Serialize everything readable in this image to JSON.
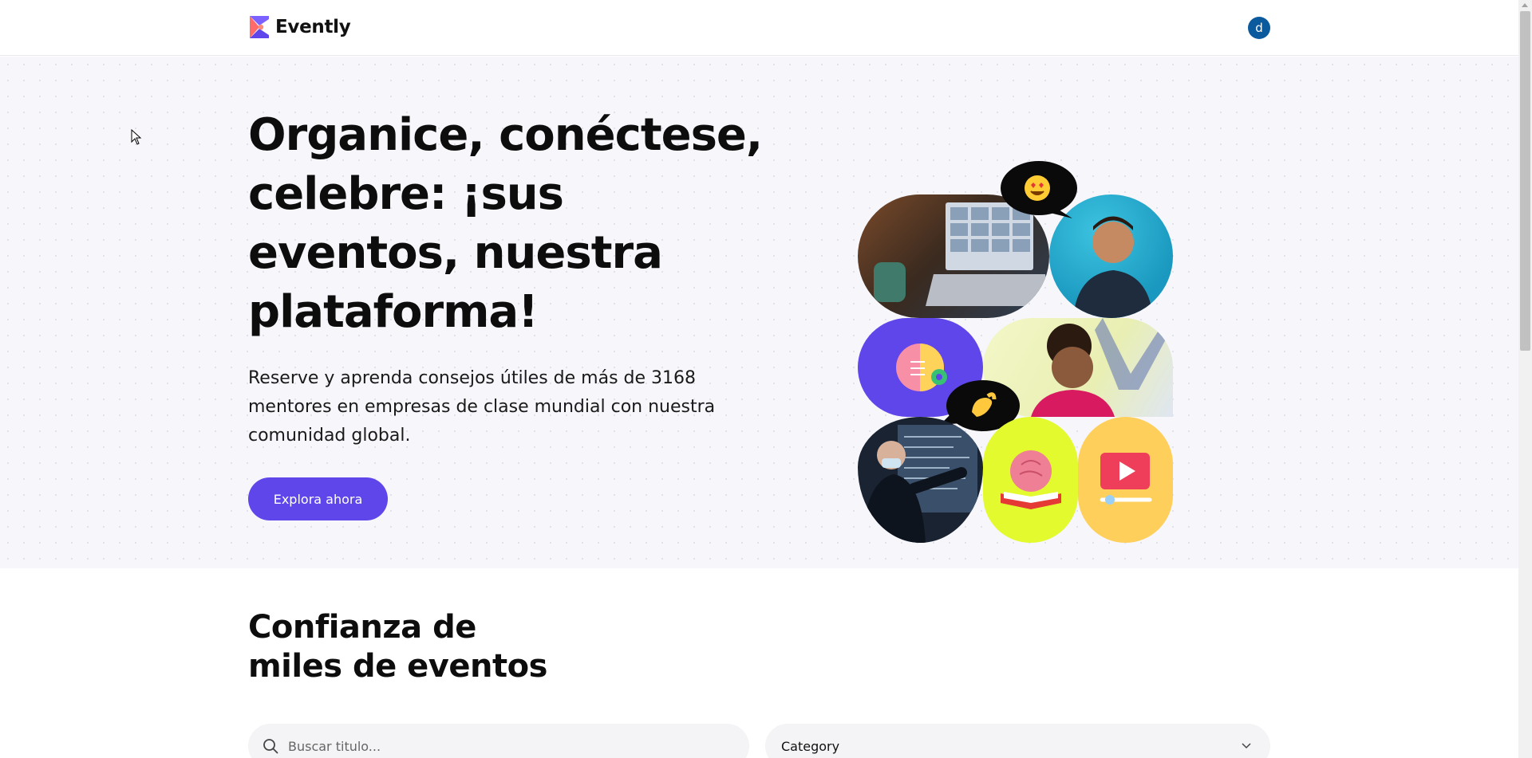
{
  "header": {
    "brand": "Evently",
    "avatar_initial": "d"
  },
  "hero": {
    "title": "Organice, conéctese, celebre: ¡sus eventos, nuestra plataforma!",
    "description": "Reserve y aprenda consejos útiles de más de 3168 mentores en empresas de clase mundial con nuestra comunidad global.",
    "cta_label": "Explora ahora",
    "collage_icons": [
      "heart-eyes-emoji-icon",
      "pinching-hand-emoji-icon",
      "lightbulb-brain-icon",
      "brain-book-icon",
      "video-play-icon"
    ]
  },
  "trust": {
    "title_line1": "Confianza de",
    "title_line2": "miles de eventos"
  },
  "filters": {
    "search_placeholder": "Buscar titulo...",
    "category_label": "Category"
  },
  "colors": {
    "accent": "#5f46ea",
    "avatar": "#0b5a9e",
    "hero_bg": "#f6f6fb"
  }
}
